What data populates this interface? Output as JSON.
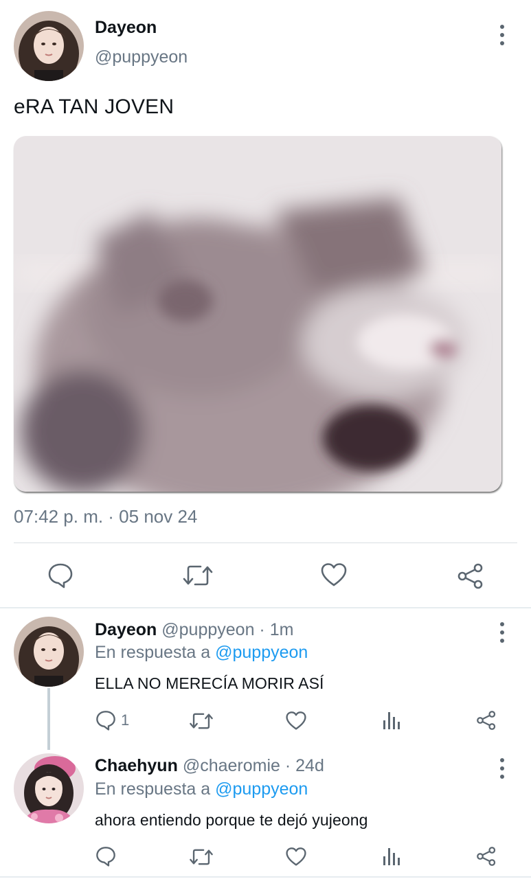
{
  "main_tweet": {
    "author_name": "Dayeon",
    "author_handle": "@puppyeon",
    "text": "eRA TAN JOVEN",
    "timestamp": "07:42 p. m. · 05 nov 24",
    "media_icon": "blurred-cat-photo",
    "actions": [
      "reply-icon",
      "retweet-icon",
      "like-icon",
      "share-icon"
    ]
  },
  "replies": [
    {
      "author_name": "Dayeon",
      "author_handle": "@puppyeon",
      "time": " · 1m",
      "in_reply_prefix": "En respuesta a ",
      "in_reply_to": "@puppyeon",
      "text": "ELLA NO MERECÍA MORIR ASÍ",
      "reply_count": "1"
    },
    {
      "author_name": "Chaehyun",
      "author_handle": "@chaeromie",
      "time": " · 24d",
      "in_reply_prefix": "En respuesta a ",
      "in_reply_to": "@puppyeon",
      "text": "ahora entiendo porque te dejó yujeong",
      "reply_count": ""
    }
  ],
  "colors": {
    "link": "#1d9bf0",
    "secondary_text": "#687684",
    "icon": "#5b6670",
    "divider": "#d9dfe3"
  }
}
